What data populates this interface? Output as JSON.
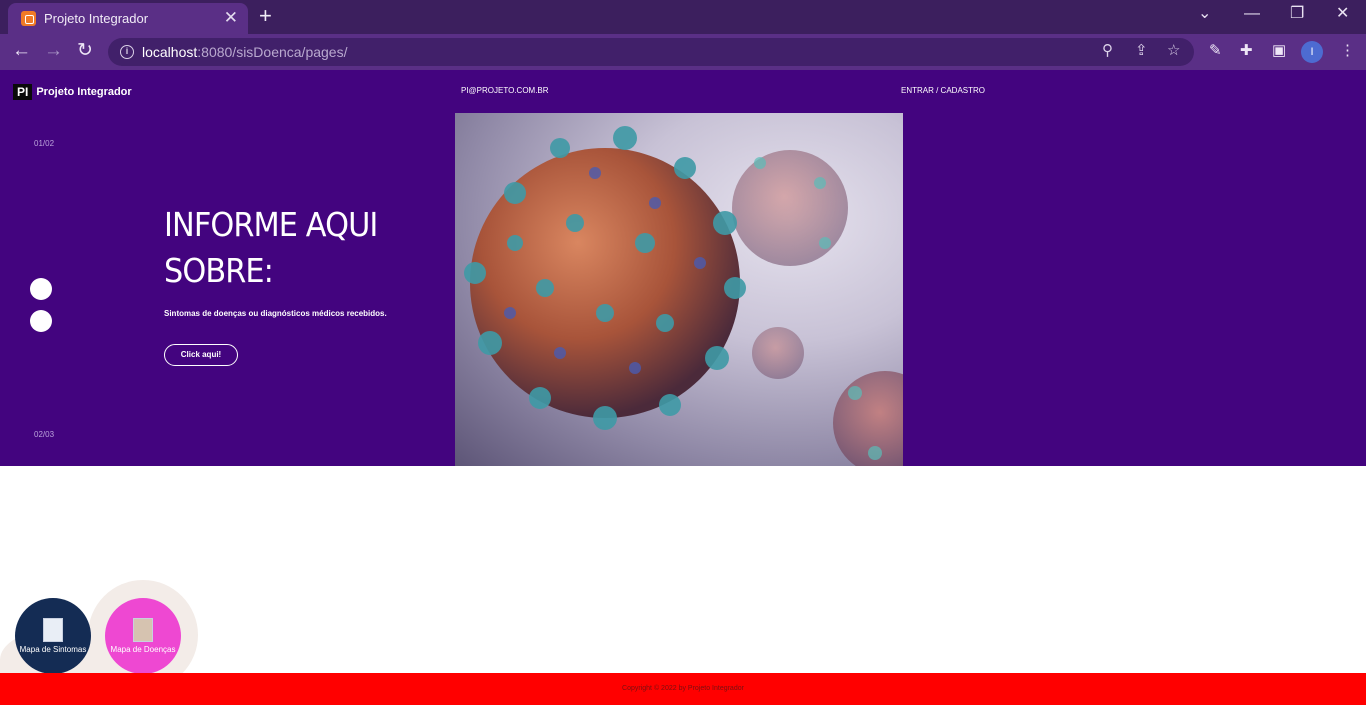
{
  "browser": {
    "tab_title": "Projeto Integrador",
    "url_host": "localhost",
    "url_rest": ":8080/sisDoenca/pages/",
    "profile_initial": "I"
  },
  "site": {
    "brand_mark": "PI",
    "brand_name": "Projeto Integrador",
    "email": "PI@PROJETO.COM.BR",
    "login": "ENTRAR / CADASTRO"
  },
  "hero": {
    "slide_top": "01/02",
    "slide_bottom": "02/03",
    "title": "INFORME AQUI SOBRE:",
    "subtitle": "Sintomas de doenças ou diagnósticos médicos recebidos.",
    "button_label": "Click aqui!",
    "colors": {
      "background": "#43047f"
    }
  },
  "floating": {
    "sintomas_label": "Mapa de Sintomas",
    "doencas_label": "Mapa de Doenças",
    "colors": {
      "sintomas": "#142c54",
      "doencas": "#ee48d2"
    }
  },
  "footer": {
    "copyright": "Copyright © 2022 by Projeto Integrador",
    "color": "#ff0000"
  }
}
